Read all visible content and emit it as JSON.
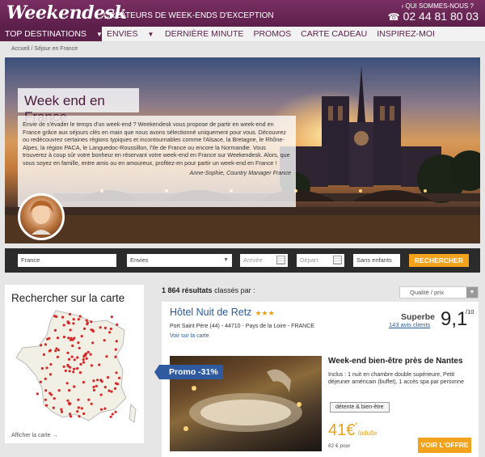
{
  "header": {
    "logo": "Weekendesk",
    "tagline": "CRÉATEURS DE WEEK-ENDS D'EXCEPTION",
    "who": "› QUI SOMMES-NOUS ?",
    "phone": "02 44 81 80 03",
    "phone_icon": "phone-icon",
    "bg_color": "#6b2657"
  },
  "nav": {
    "items": [
      {
        "label": "TOP DESTINATIONS",
        "caret": "▼"
      },
      {
        "label": "ENVIES",
        "caret": "▼"
      },
      {
        "label": "DERNIÈRE MINUTE"
      },
      {
        "label": "PROMOS"
      },
      {
        "label": "CARTE CADEAU"
      },
      {
        "label": "INSPIREZ-MOI"
      }
    ]
  },
  "breadcrumb": "Accueil / Séjour en France",
  "hero": {
    "title": "Week end en France",
    "text": "Envie de s'évader le temps d'un week-end ? Weekendesk vous propose de partir en week-end en France grâce aux séjours clés en main que nous avons sélectionné uniquement pour vous. Découvrez ou redécouvrez certaines régions typiques et incontournables comme l'Alsace, la Bretagne, le Rhône-Alpes, la région PACA, le Languedoc-Roussillon, l'Ile de France ou encore la Normandie. Vous trouverez à coup sûr votre bonheur en réservant votre week-end en France sur Weekendesk. Alors, que vous soyez en famille, entre amis ou en amoureux, profitez-en pour partir un week-end en France !",
    "signature": "Anne-Sophie, Country Manager France"
  },
  "search": {
    "destination": "France",
    "envies": "Envies",
    "arrivee": "Arrivée",
    "depart": "Départ",
    "enfants": "Sans enfants",
    "button": "RECHERCHER",
    "accent": "#f3a21b"
  },
  "map": {
    "title": "Rechercher sur la carte",
    "link": "Afficher la carte →"
  },
  "results": {
    "count": "1 864 résultats",
    "count_suffix": "classés par :",
    "sort": "Qualité / prix"
  },
  "card": {
    "name": "Hôtel Nuit de Retz",
    "stars": "★★★",
    "address": "Port Saint Père (44) - 44710 - Pays de la Loire - FRANCE",
    "map_link": "Voir sur la carte",
    "rating_word": "Superbe",
    "rating_count": "143 avis clients",
    "rating_score": "9,1",
    "rating_scale": "/10",
    "promo": "Promo -31%",
    "offer_title": "Week-end bien-être près de Nantes",
    "offer_desc": "Inclus : 1 nuit en chambre double supérieure, Petit déjeuner américain (buffet), 1 accès spa par personne",
    "tag": "détente & bien-être",
    "price": "41€",
    "price_sup": "*",
    "price_unit": "/adulte",
    "price_old": "82 € pour",
    "button": "VOIR L'OFFRE"
  }
}
